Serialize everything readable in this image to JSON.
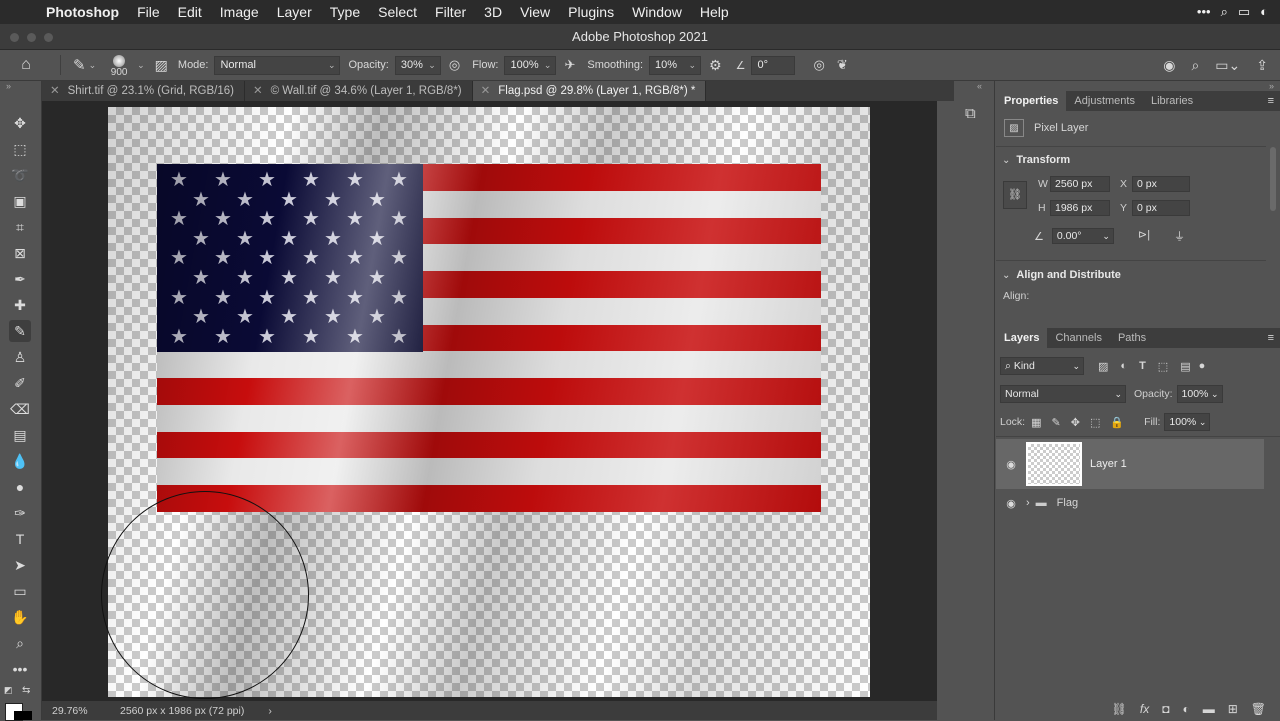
{
  "menubar": {
    "app": "Photoshop",
    "items": [
      "File",
      "Edit",
      "Image",
      "Layer",
      "Type",
      "Select",
      "Filter",
      "3D",
      "View",
      "Plugins",
      "Window",
      "Help"
    ]
  },
  "window": {
    "title": "Adobe Photoshop 2021"
  },
  "options": {
    "brush_size": "900",
    "mode_label": "Mode:",
    "mode_value": "Normal",
    "opacity_label": "Opacity:",
    "opacity_value": "30%",
    "flow_label": "Flow:",
    "flow_value": "100%",
    "smoothing_label": "Smoothing:",
    "smoothing_value": "10%",
    "angle_value": "0°"
  },
  "tabs": [
    {
      "label": "Shirt.tif @ 23.1% (Grid, RGB/16)"
    },
    {
      "label": "© Wall.tif @ 34.6% (Layer 1, RGB/8*)"
    },
    {
      "label": "Flag.psd @ 29.8% (Layer 1, RGB/8*) *"
    }
  ],
  "status": {
    "zoom": "29.76%",
    "doc_info": "2560 px x 1986 px (72 ppi)"
  },
  "properties": {
    "tabs": [
      "Properties",
      "Adjustments",
      "Libraries"
    ],
    "kind": "Pixel Layer",
    "transform_title": "Transform",
    "w_label": "W",
    "w_value": "2560 px",
    "h_label": "H",
    "h_value": "1986 px",
    "x_label": "X",
    "x_value": "0 px",
    "y_label": "Y",
    "y_value": "0 px",
    "angle_value": "0.00°",
    "align_title": "Align and Distribute",
    "align_label": "Align:"
  },
  "layers": {
    "tabs": [
      "Layers",
      "Channels",
      "Paths"
    ],
    "filter_kind": "Kind",
    "blend_mode": "Normal",
    "opacity_label": "Opacity:",
    "opacity_value": "100%",
    "lock_label": "Lock:",
    "fill_label": "Fill:",
    "fill_value": "100%",
    "items": [
      {
        "name": "Layer 1"
      },
      {
        "name": "Flag"
      }
    ]
  },
  "colors": {
    "flag_red": "#c70d0d",
    "flag_white": "#e9e9e9",
    "flag_blue": "#0a0a35"
  },
  "icons": [
    "home-icon",
    "brush-icon",
    "move-icon",
    "marquee-icon",
    "lasso-icon",
    "crop-icon",
    "eyedropper-icon",
    "eye-icon"
  ]
}
